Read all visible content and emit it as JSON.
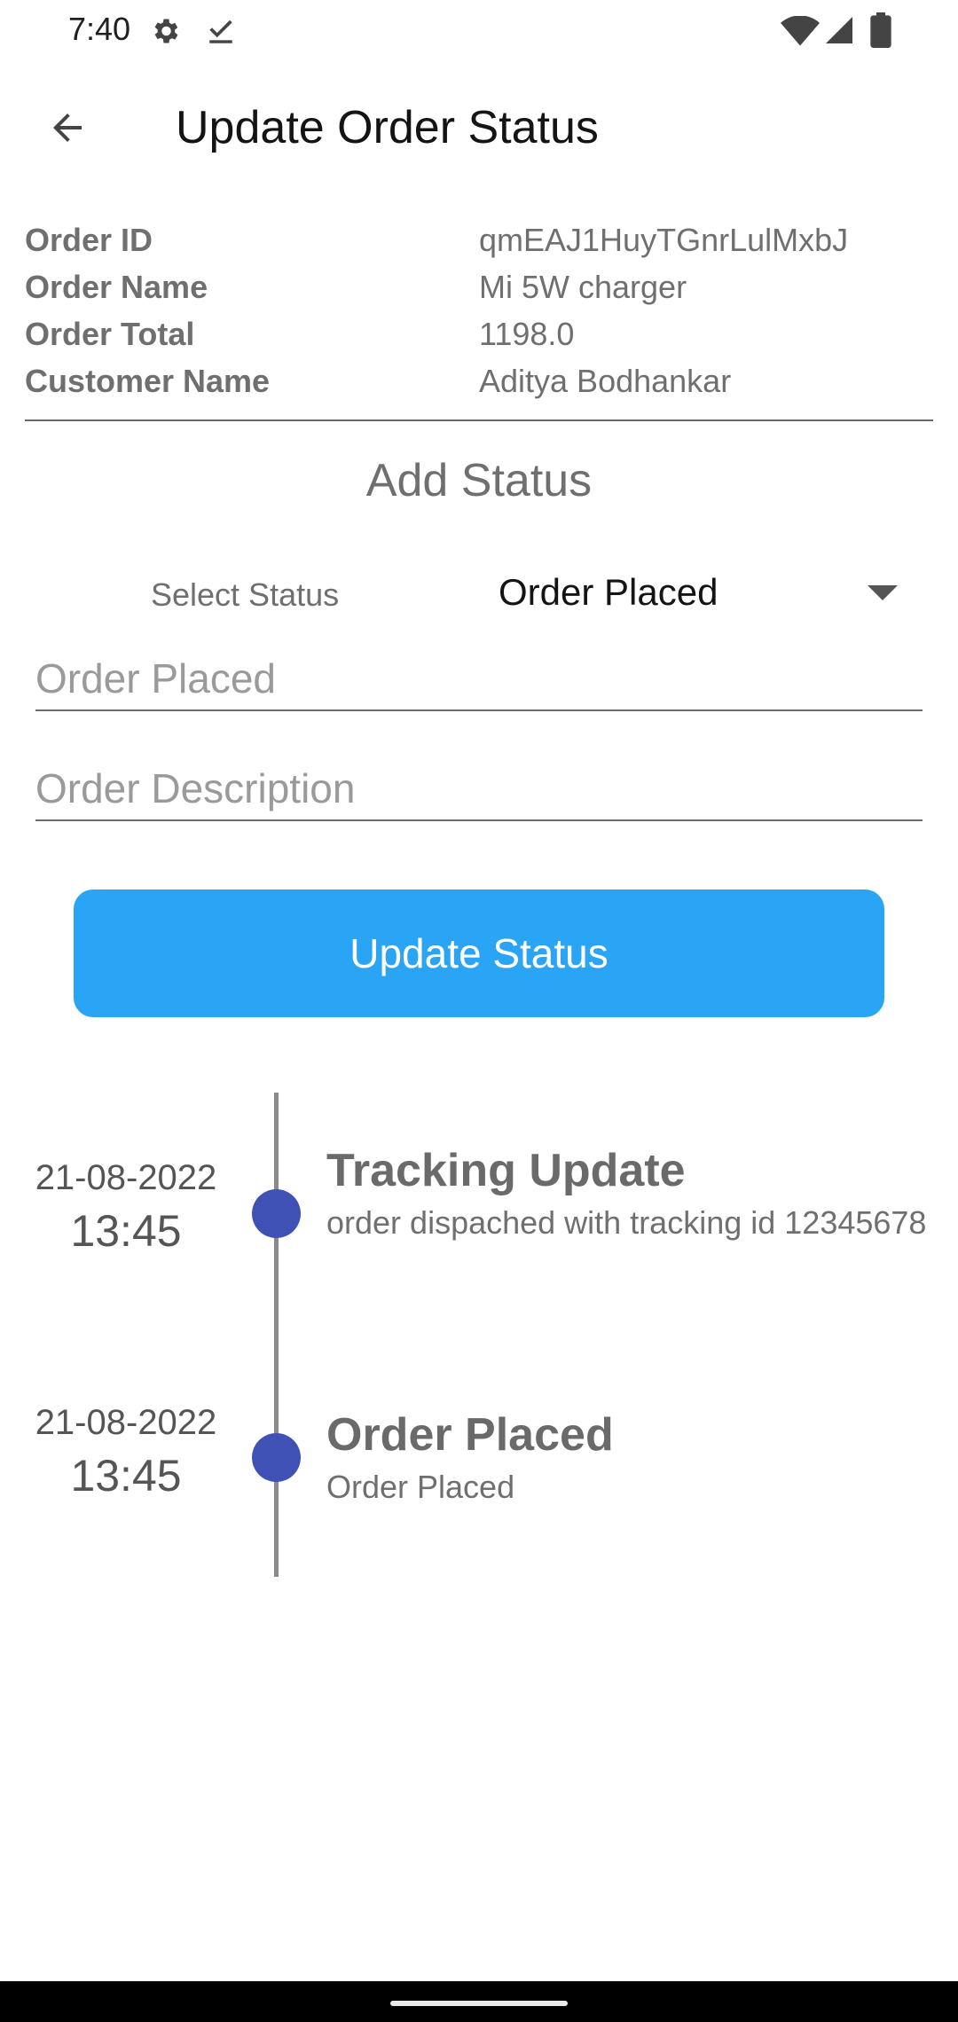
{
  "status_bar": {
    "time": "7:40",
    "icons": [
      "gear-icon",
      "checkmark-icon",
      "wifi-icon",
      "signal-icon",
      "battery-icon"
    ]
  },
  "app_bar": {
    "back_icon": "arrow-left-icon",
    "title": "Update Order Status"
  },
  "order_info": {
    "rows": [
      {
        "label": "Order ID",
        "value": "qmEAJ1HuyTGnrLulMxbJ"
      },
      {
        "label": "Order Name",
        "value": "Mi 5W charger"
      },
      {
        "label": "Order Total",
        "value": "1198.0"
      },
      {
        "label": "Customer Name",
        "value": "Aditya Bodhankar"
      }
    ]
  },
  "add_status": {
    "title": "Add Status",
    "select_label": "Select Status",
    "selected_value": "Order Placed",
    "status_field_placeholder": "Order Placed",
    "description_placeholder": "Order Description",
    "button_label": "Update Status"
  },
  "timeline": [
    {
      "date": "21-08-2022",
      "time": "13:45",
      "title": "Tracking Update",
      "description": "order dispached with tracking id 12345678"
    },
    {
      "date": "21-08-2022",
      "time": "13:45",
      "title": "Order Placed",
      "description": "Order Placed"
    }
  ],
  "colors": {
    "accent": "#2aa5f6",
    "timeline_dot": "#3f51b5",
    "muted_text": "#6f6f6f"
  }
}
